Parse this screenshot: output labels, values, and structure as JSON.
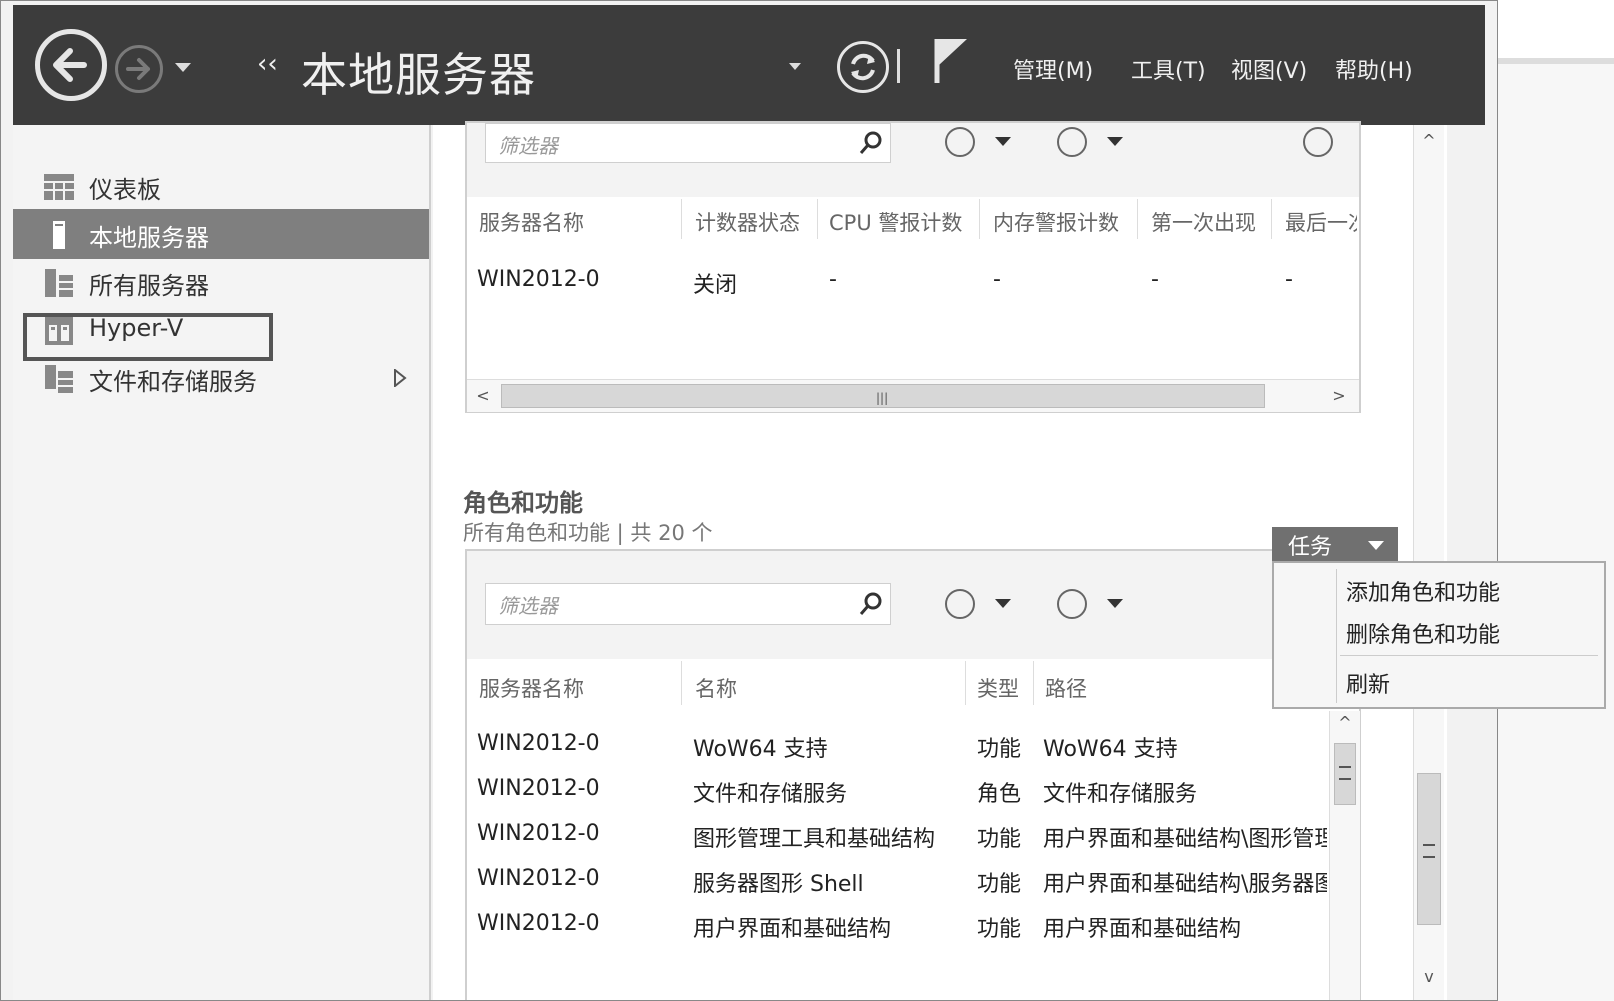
{
  "header": {
    "title": "本地服务器",
    "menu": [
      "管理(M)",
      "工具(T)",
      "视图(V)",
      "帮助(H)"
    ]
  },
  "sidebar": {
    "items": [
      {
        "label": "仪表板",
        "icon": "dashboard-icon"
      },
      {
        "label": "本地服务器",
        "icon": "server-icon"
      },
      {
        "label": "所有服务器",
        "icon": "servers-icon"
      },
      {
        "label": "Hyper-V",
        "icon": "hyperv-icon"
      },
      {
        "label": "文件和存储服务",
        "icon": "storage-icon"
      }
    ]
  },
  "performance": {
    "filter_placeholder": "筛选器",
    "columns": [
      "服务器名称",
      "计数器状态",
      "CPU 警报计数",
      "内存警报计数",
      "第一次出现",
      "最后一次"
    ],
    "rows": [
      [
        "WIN2012-0",
        "关闭",
        "-",
        "-",
        "-",
        "-"
      ]
    ]
  },
  "roles": {
    "heading": "角色和功能",
    "subheading": "所有角色和功能 | 共 20 个",
    "tasks_label": "任务",
    "filter_placeholder": "筛选器",
    "columns": [
      "服务器名称",
      "名称",
      "类型",
      "路径"
    ],
    "rows": [
      [
        "WIN2012-0",
        "WoW64 支持",
        "功能",
        "WoW64 支持"
      ],
      [
        "WIN2012-0",
        "文件和存储服务",
        "角色",
        "文件和存储服务"
      ],
      [
        "WIN2012-0",
        "图形管理工具和基础结构",
        "功能",
        "用户界面和基础结构\\图形管理"
      ],
      [
        "WIN2012-0",
        "服务器图形 Shell",
        "功能",
        "用户界面和基础结构\\服务器图"
      ],
      [
        "WIN2012-0",
        "用户界面和基础结构",
        "功能",
        "用户界面和基础结构"
      ]
    ]
  },
  "context_menu": {
    "items": [
      "添加角色和功能",
      "删除角色和功能",
      "刷新"
    ]
  },
  "colors": {
    "header_bg": "#3c3c3c",
    "sidebar_active": "#7f7f7f",
    "task_button": "#707070"
  }
}
